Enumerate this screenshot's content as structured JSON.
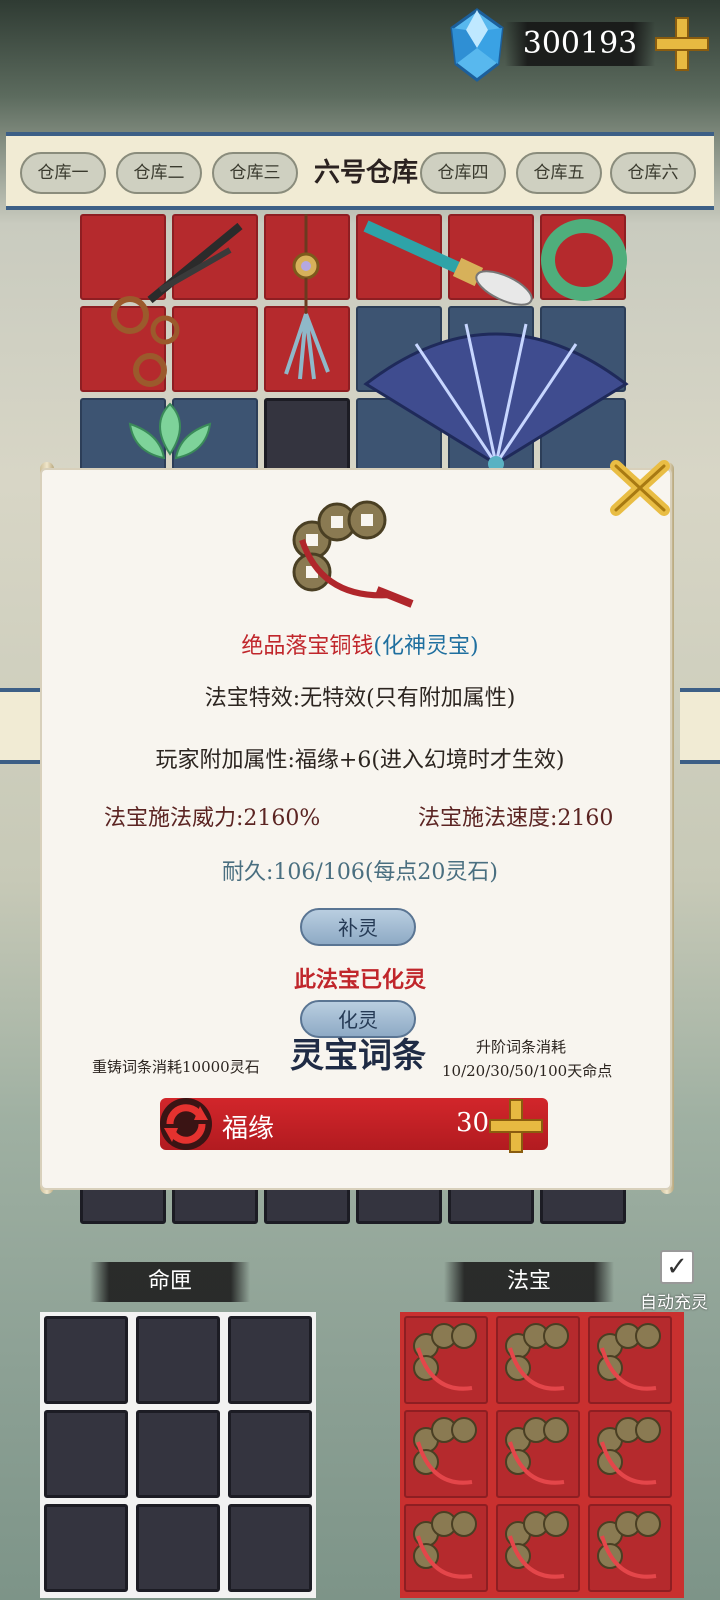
{
  "currency": {
    "icon": "diamond-gem-icon",
    "value": "300193",
    "plus_icon": "plus-icon"
  },
  "warehouse_tabs": {
    "active": "六号仓库",
    "tabs": [
      "仓库一",
      "仓库二",
      "仓库三",
      "仓库四",
      "仓库五",
      "仓库六"
    ]
  },
  "storage_items": [
    {
      "name": "scissors-icon"
    },
    {
      "name": "pendant-tassel-icon"
    },
    {
      "name": "brush-icon"
    },
    {
      "name": "jade-bracelet-icon"
    },
    {
      "name": "lotus-icon"
    },
    {
      "name": "folding-fan-icon"
    }
  ],
  "item_detail": {
    "icon": "copper-coins-icon",
    "name": "绝品落宝铜钱",
    "tier": "(化神灵宝)",
    "effect": "法宝特效:无特效(只有附加属性)",
    "player_attr": "玩家附加属性:福缘+6(进入幻境时才生效)",
    "power": "法宝施法威力:2160%",
    "speed": "法宝施法速度:2160",
    "durability": "耐久:106/106(每点20灵石)",
    "recharge_label": "补灵",
    "spiritualized_text": "此法宝已化灵",
    "spiritualize_label": "化灵",
    "reforge_cost": "重铸词条消耗10000灵石",
    "affix_title": "灵宝词条",
    "upgrade_label": "升阶词条消耗",
    "upgrade_values": "10/20/30/50/100天命点",
    "affix": {
      "name": "福缘",
      "value": "30"
    }
  },
  "sections": {
    "fate": "命匣",
    "treasure": "法宝",
    "auto_label": "自动充灵",
    "auto_checked": true
  },
  "colors": {
    "accent_red": "#c0262b",
    "tier_blue": "#1f6f9f",
    "frame_blue": "#3d5f86"
  }
}
